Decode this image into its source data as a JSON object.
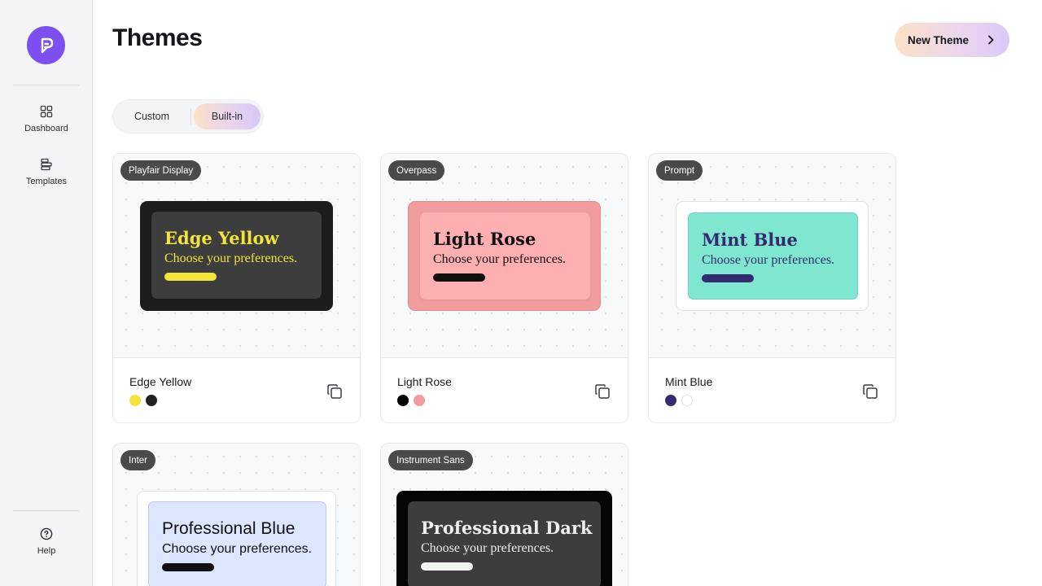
{
  "sidebar": {
    "logo_icon": "logo-icon",
    "items": [
      {
        "label": "Dashboard",
        "icon": "dashboard-icon"
      },
      {
        "label": "Templates",
        "icon": "templates-icon"
      }
    ],
    "help": {
      "label": "Help",
      "icon": "help-icon"
    }
  },
  "header": {
    "title": "Themes",
    "new_theme_label": "New Theme"
  },
  "tabs": [
    {
      "label": "Custom",
      "selected": false
    },
    {
      "label": "Built-in",
      "selected": true
    }
  ],
  "themes": [
    {
      "name": "Edge Yellow",
      "font": "Playfair Display",
      "preview_title": "Edge Yellow",
      "preview_subtitle": "Choose your preferences.",
      "colors": {
        "outer": "#1c1c1c",
        "inner": "#3d3d3d",
        "text": "#f2e43a",
        "bar": "#f2e43a"
      },
      "swatches": [
        "#f2e43a",
        "#222222"
      ]
    },
    {
      "name": "Light Rose",
      "font": "Overpass",
      "preview_title": "Light Rose",
      "preview_subtitle": "Choose your preferences.",
      "colors": {
        "outer": "#f19c9f",
        "inner": "#feafb2",
        "text": "#111111",
        "bar": "#111111"
      },
      "swatches": [
        "#000000",
        "#f19c9f"
      ]
    },
    {
      "name": "Mint Blue",
      "font": "Prompt",
      "preview_title": "Mint Blue",
      "preview_subtitle": "Choose your preferences.",
      "colors": {
        "outer": "#ffffff",
        "inner": "#7fe6cf",
        "text": "#352a72",
        "bar": "#352a72"
      },
      "swatches": [
        "#352a72",
        "#ffffff"
      ]
    },
    {
      "name": "Professional Blue",
      "font": "Inter",
      "preview_title": "Professional Blue",
      "preview_subtitle": "Choose your preferences.",
      "colors": {
        "outer": "#ffffff",
        "inner": "#dce6ff",
        "text": "#111111",
        "bar": "#111111"
      },
      "swatches": []
    },
    {
      "name": "Professional Dark",
      "font": "Instrument Sans",
      "preview_title": "Professional Dark",
      "preview_subtitle": "Choose your preferences.",
      "colors": {
        "outer": "#050505",
        "inner": "#3d3d3d",
        "text": "#eeeeee",
        "bar": "#eef3ee"
      },
      "swatches": []
    }
  ]
}
